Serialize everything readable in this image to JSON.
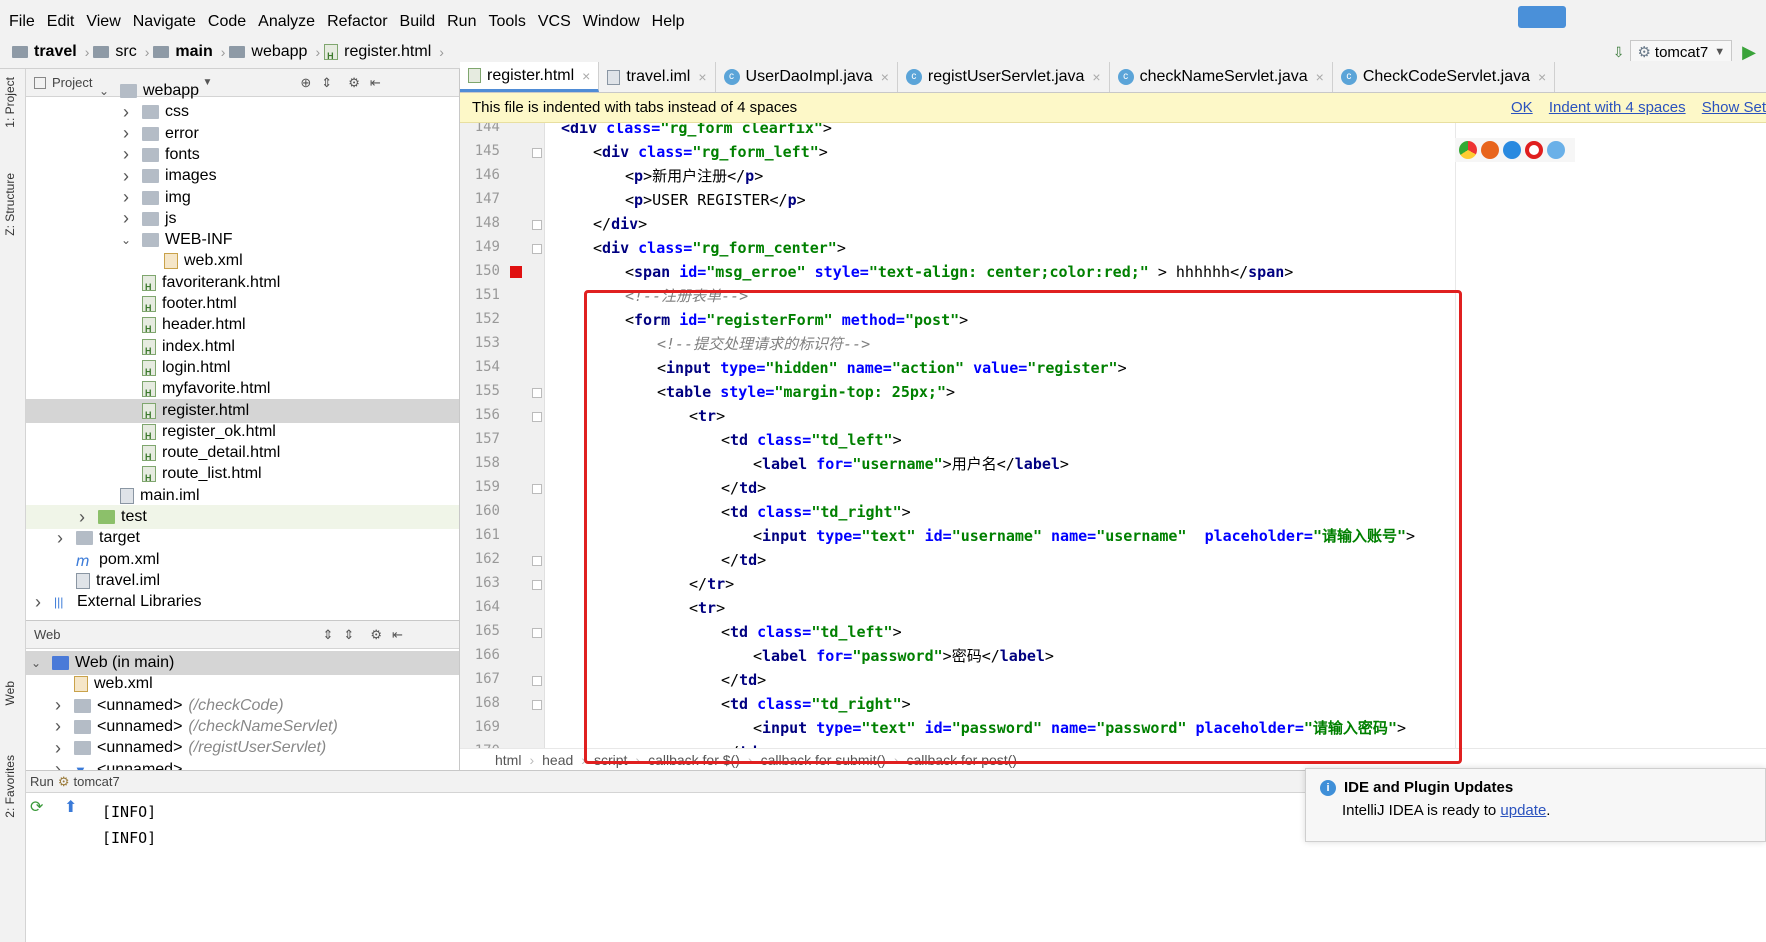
{
  "menu": [
    "File",
    "Edit",
    "View",
    "Navigate",
    "Code",
    "Analyze",
    "Refactor",
    "Build",
    "Run",
    "Tools",
    "VCS",
    "Window",
    "Help"
  ],
  "breadcrumb": [
    "travel",
    "src",
    "main",
    "webapp",
    "register.html"
  ],
  "run_config": "tomcat7",
  "tool_windows": {
    "project": "1: Project",
    "structure": "Z: Structure",
    "web": "Web",
    "favorites": "2: Favorites"
  },
  "project_panel": {
    "title": "Project",
    "items": [
      {
        "label": "webapp",
        "depth": 3,
        "type": "folder",
        "chev": "open"
      },
      {
        "label": "css",
        "depth": 4,
        "type": "folder",
        "chev": "closed"
      },
      {
        "label": "error",
        "depth": 4,
        "type": "folder",
        "chev": "closed"
      },
      {
        "label": "fonts",
        "depth": 4,
        "type": "folder",
        "chev": "closed"
      },
      {
        "label": "images",
        "depth": 4,
        "type": "folder",
        "chev": "closed"
      },
      {
        "label": "img",
        "depth": 4,
        "type": "folder",
        "chev": "closed"
      },
      {
        "label": "js",
        "depth": 4,
        "type": "folder",
        "chev": "closed"
      },
      {
        "label": "WEB-INF",
        "depth": 4,
        "type": "folder",
        "chev": "open"
      },
      {
        "label": "web.xml",
        "depth": 5,
        "type": "xml",
        "chev": "none"
      },
      {
        "label": "favoriterank.html",
        "depth": 4,
        "type": "html",
        "chev": "none"
      },
      {
        "label": "footer.html",
        "depth": 4,
        "type": "html",
        "chev": "none"
      },
      {
        "label": "header.html",
        "depth": 4,
        "type": "html",
        "chev": "none"
      },
      {
        "label": "index.html",
        "depth": 4,
        "type": "html",
        "chev": "none"
      },
      {
        "label": "login.html",
        "depth": 4,
        "type": "html",
        "chev": "none"
      },
      {
        "label": "myfavorite.html",
        "depth": 4,
        "type": "html",
        "chev": "none"
      },
      {
        "label": "register.html",
        "depth": 4,
        "type": "html",
        "chev": "none",
        "selected": true
      },
      {
        "label": "register_ok.html",
        "depth": 4,
        "type": "html",
        "chev": "none"
      },
      {
        "label": "route_detail.html",
        "depth": 4,
        "type": "html",
        "chev": "none"
      },
      {
        "label": "route_list.html",
        "depth": 4,
        "type": "html",
        "chev": "none"
      },
      {
        "label": "main.iml",
        "depth": 3,
        "type": "iml",
        "chev": "none"
      },
      {
        "label": "test",
        "depth": 2,
        "type": "folder-green",
        "chev": "closed",
        "test": true
      },
      {
        "label": "target",
        "depth": 1,
        "type": "folder",
        "chev": "closed"
      },
      {
        "label": "pom.xml",
        "depth": 1,
        "type": "pom",
        "chev": "none"
      },
      {
        "label": "travel.iml",
        "depth": 1,
        "type": "iml",
        "chev": "none"
      },
      {
        "label": "External Libraries",
        "depth": 0,
        "type": "lib",
        "chev": "closed"
      }
    ]
  },
  "web_panel": {
    "title": "Web",
    "items": [
      {
        "label": "Web (in main)",
        "sub": "",
        "depth": 0,
        "chev": "open",
        "selected": true
      },
      {
        "label": "web.xml",
        "sub": "",
        "depth": 1,
        "chev": "none"
      },
      {
        "label": "<unnamed>",
        "sub": "(/checkCode)",
        "depth": 1,
        "chev": "closed"
      },
      {
        "label": "<unnamed>",
        "sub": "(/checkNameServlet)",
        "depth": 1,
        "chev": "closed"
      },
      {
        "label": "<unnamed>",
        "sub": "(/registUserServlet)",
        "depth": 1,
        "chev": "closed"
      },
      {
        "label": "<unnamed>",
        "sub": "",
        "depth": 1,
        "chev": "closed"
      }
    ]
  },
  "editor_tabs": [
    {
      "label": "register.html",
      "kind": "html",
      "active": true
    },
    {
      "label": "travel.iml",
      "kind": "iml",
      "active": false
    },
    {
      "label": "UserDaoImpl.java",
      "kind": "class",
      "active": false
    },
    {
      "label": "registUserServlet.java",
      "kind": "class",
      "active": false
    },
    {
      "label": "checkNameServlet.java",
      "kind": "class",
      "active": false
    },
    {
      "label": "CheckCodeServlet.java",
      "kind": "class",
      "active": false
    }
  ],
  "notice": {
    "text": "This file is indented with tabs instead of 4 spaces",
    "links": [
      "OK",
      "Indent with 4 spaces",
      "Show Set"
    ]
  },
  "code": {
    "first_line": 144,
    "lines": [
      {
        "n": "144",
        "indent": 3,
        "parts": [
          [
            "tag",
            "<div "
          ],
          [
            "attr",
            "class="
          ],
          [
            "val",
            "\"rg_form clearfix\""
          ],
          [
            "ang",
            ">"
          ]
        ]
      },
      {
        "n": "145",
        "indent": 4,
        "parts": [
          [
            "ang",
            "<"
          ],
          [
            "tag",
            "div "
          ],
          [
            "attr",
            "class="
          ],
          [
            "val",
            "\"rg_form_left\""
          ],
          [
            "ang",
            ">"
          ]
        ]
      },
      {
        "n": "146",
        "indent": 5,
        "parts": [
          [
            "ang",
            "<"
          ],
          [
            "tag",
            "p"
          ],
          [
            "ang",
            ">"
          ],
          [
            "txt",
            "新用户注册"
          ],
          [
            "ang",
            "</"
          ],
          [
            "tag",
            "p"
          ],
          [
            "ang",
            ">"
          ]
        ]
      },
      {
        "n": "147",
        "indent": 5,
        "parts": [
          [
            "ang",
            "<"
          ],
          [
            "tag",
            "p"
          ],
          [
            "ang",
            ">"
          ],
          [
            "txt",
            "USER REGISTER"
          ],
          [
            "ang",
            "</"
          ],
          [
            "tag",
            "p"
          ],
          [
            "ang",
            ">"
          ]
        ]
      },
      {
        "n": "148",
        "indent": 4,
        "parts": [
          [
            "ang",
            "</"
          ],
          [
            "tag",
            "div"
          ],
          [
            "ang",
            ">"
          ]
        ]
      },
      {
        "n": "149",
        "indent": 4,
        "parts": [
          [
            "ang",
            "<"
          ],
          [
            "tag",
            "div "
          ],
          [
            "attr",
            "class="
          ],
          [
            "val",
            "\"rg_form_center\""
          ],
          [
            "ang",
            ">"
          ]
        ]
      },
      {
        "n": "150",
        "indent": 5,
        "parts": [
          [
            "ang",
            "<"
          ],
          [
            "tag",
            "span "
          ],
          [
            "attr",
            "id="
          ],
          [
            "val",
            "\"msg_erroe\" "
          ],
          [
            "attr",
            "style="
          ],
          [
            "val",
            "\"text-align: center;color:red;\""
          ],
          [
            "ang",
            " > "
          ],
          [
            "txt",
            "hhhhhh"
          ],
          [
            "ang",
            "</"
          ],
          [
            "tag",
            "span"
          ],
          [
            "ang",
            ">"
          ]
        ]
      },
      {
        "n": "151",
        "indent": 5,
        "parts": [
          [
            "cm",
            "<!--注册表单-->"
          ]
        ]
      },
      {
        "n": "152",
        "indent": 5,
        "parts": [
          [
            "ang",
            "<"
          ],
          [
            "tag",
            "form "
          ],
          [
            "attr",
            "id="
          ],
          [
            "val",
            "\"registerForm\" "
          ],
          [
            "attr",
            "method="
          ],
          [
            "val",
            "\"post\""
          ],
          [
            "ang",
            ">"
          ]
        ]
      },
      {
        "n": "153",
        "indent": 6,
        "parts": [
          [
            "cm",
            "<!--提交处理请求的标识符-->"
          ]
        ]
      },
      {
        "n": "154",
        "indent": 6,
        "parts": [
          [
            "ang",
            "<"
          ],
          [
            "tag",
            "input "
          ],
          [
            "attr",
            "type="
          ],
          [
            "val",
            "\"hidden\" "
          ],
          [
            "attr",
            "name="
          ],
          [
            "val",
            "\"action\" "
          ],
          [
            "attr",
            "value="
          ],
          [
            "val",
            "\"register\""
          ],
          [
            "ang",
            ">"
          ]
        ]
      },
      {
        "n": "155",
        "indent": 6,
        "parts": [
          [
            "ang",
            "<"
          ],
          [
            "tag",
            "table "
          ],
          [
            "attr",
            "style="
          ],
          [
            "val",
            "\"margin-top: 25px;\""
          ],
          [
            "ang",
            ">"
          ]
        ]
      },
      {
        "n": "156",
        "indent": 7,
        "parts": [
          [
            "ang",
            "<"
          ],
          [
            "tag",
            "tr"
          ],
          [
            "ang",
            ">"
          ]
        ]
      },
      {
        "n": "157",
        "indent": 8,
        "parts": [
          [
            "ang",
            "<"
          ],
          [
            "tag",
            "td "
          ],
          [
            "attr",
            "class="
          ],
          [
            "val",
            "\"td_left\""
          ],
          [
            "ang",
            ">"
          ]
        ]
      },
      {
        "n": "158",
        "indent": 9,
        "parts": [
          [
            "ang",
            "<"
          ],
          [
            "tag",
            "label "
          ],
          [
            "attr",
            "for="
          ],
          [
            "val",
            "\"username\""
          ],
          [
            "ang",
            ">"
          ],
          [
            "txt",
            "用户名"
          ],
          [
            "ang",
            "</"
          ],
          [
            "tag",
            "label"
          ],
          [
            "ang",
            ">"
          ]
        ]
      },
      {
        "n": "159",
        "indent": 8,
        "parts": [
          [
            "ang",
            "</"
          ],
          [
            "tag",
            "td"
          ],
          [
            "ang",
            ">"
          ]
        ]
      },
      {
        "n": "160",
        "indent": 8,
        "parts": [
          [
            "ang",
            "<"
          ],
          [
            "tag",
            "td "
          ],
          [
            "attr",
            "class="
          ],
          [
            "val",
            "\"td_right\""
          ],
          [
            "ang",
            ">"
          ]
        ]
      },
      {
        "n": "161",
        "indent": 9,
        "parts": [
          [
            "ang",
            "<"
          ],
          [
            "tag",
            "input "
          ],
          [
            "attr",
            "type="
          ],
          [
            "val",
            "\"text\" "
          ],
          [
            "attr",
            "id="
          ],
          [
            "val",
            "\"username\" "
          ],
          [
            "attr",
            "name="
          ],
          [
            "val",
            "\"username\"  "
          ],
          [
            "attr",
            "placeholder="
          ],
          [
            "val",
            "\"请输入账号\""
          ],
          [
            "ang",
            ">"
          ]
        ]
      },
      {
        "n": "162",
        "indent": 8,
        "parts": [
          [
            "ang",
            "</"
          ],
          [
            "tag",
            "td"
          ],
          [
            "ang",
            ">"
          ]
        ]
      },
      {
        "n": "163",
        "indent": 7,
        "parts": [
          [
            "ang",
            "</"
          ],
          [
            "tag",
            "tr"
          ],
          [
            "ang",
            ">"
          ]
        ]
      },
      {
        "n": "164",
        "indent": 7,
        "parts": [
          [
            "ang",
            "<"
          ],
          [
            "tag",
            "tr"
          ],
          [
            "ang",
            ">"
          ]
        ]
      },
      {
        "n": "165",
        "indent": 8,
        "parts": [
          [
            "ang",
            "<"
          ],
          [
            "tag",
            "td "
          ],
          [
            "attr",
            "class="
          ],
          [
            "val",
            "\"td_left\""
          ],
          [
            "ang",
            ">"
          ]
        ]
      },
      {
        "n": "166",
        "indent": 9,
        "parts": [
          [
            "ang",
            "<"
          ],
          [
            "tag",
            "label "
          ],
          [
            "attr",
            "for="
          ],
          [
            "val",
            "\"password\""
          ],
          [
            "ang",
            ">"
          ],
          [
            "txt",
            "密码"
          ],
          [
            "ang",
            "</"
          ],
          [
            "tag",
            "label"
          ],
          [
            "ang",
            ">"
          ]
        ]
      },
      {
        "n": "167",
        "indent": 8,
        "parts": [
          [
            "ang",
            "</"
          ],
          [
            "tag",
            "td"
          ],
          [
            "ang",
            ">"
          ]
        ]
      },
      {
        "n": "168",
        "indent": 8,
        "parts": [
          [
            "ang",
            "<"
          ],
          [
            "tag",
            "td "
          ],
          [
            "attr",
            "class="
          ],
          [
            "val",
            "\"td_right\""
          ],
          [
            "ang",
            ">"
          ]
        ]
      },
      {
        "n": "169",
        "indent": 9,
        "parts": [
          [
            "ang",
            "<"
          ],
          [
            "tag",
            "input "
          ],
          [
            "attr",
            "type="
          ],
          [
            "val",
            "\"text\" "
          ],
          [
            "attr",
            "id="
          ],
          [
            "val",
            "\"password\" "
          ],
          [
            "attr",
            "name="
          ],
          [
            "val",
            "\"password\" "
          ],
          [
            "attr",
            "placeholder="
          ],
          [
            "val",
            "\"请输入密码\""
          ],
          [
            "ang",
            ">"
          ]
        ]
      },
      {
        "n": "170",
        "indent": 8,
        "parts": [
          [
            "ang",
            "</"
          ],
          [
            "tag",
            "td"
          ],
          [
            "ang",
            ">"
          ]
        ]
      }
    ]
  },
  "code_breadcrumb": [
    "html",
    "head",
    "script",
    "callback for $()",
    "callback for submit()",
    "callback for post()"
  ],
  "run_panel": {
    "label": "Run",
    "config": "tomcat7",
    "lines": [
      "[INFO]",
      "[INFO]"
    ]
  },
  "popup": {
    "title": "IDE and Plugin Updates",
    "body": "IntelliJ IDEA is ready to ",
    "link": "update",
    "tail": "."
  },
  "colors": {
    "highlight_box": "#e02020",
    "selection": "#d5d5d5",
    "notice_bg": "#fdf8c8",
    "link": "#2a52be"
  }
}
